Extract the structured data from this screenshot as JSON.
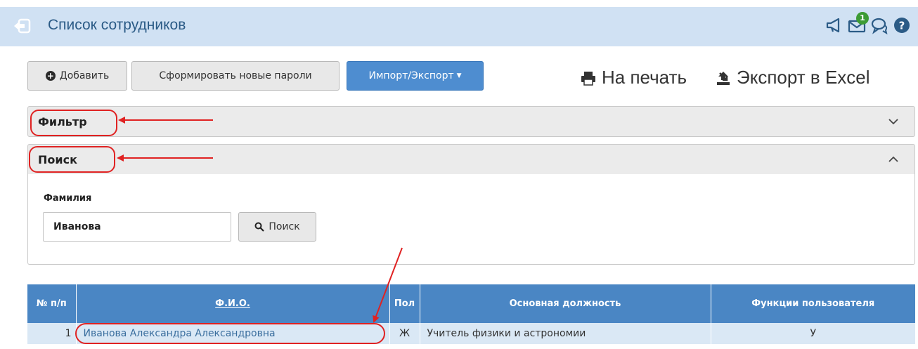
{
  "header": {
    "title": "Список сотрудников",
    "icons": [
      "back-icon",
      "megaphone-icon",
      "mail-icon",
      "chat-icon",
      "help-icon"
    ],
    "mail_badge": "1"
  },
  "toolbar": {
    "add_label": "Добавить",
    "passwords_label": "Сформировать новые пароли",
    "import_export_label": "Импорт/Экспорт",
    "print_label": "На печать",
    "excel_label": "Экспорт в Excel"
  },
  "filter_panel": {
    "title": "Фильтр",
    "state": "collapsed"
  },
  "search_panel": {
    "title": "Поиск",
    "state": "expanded",
    "surname_label": "Фамилия",
    "surname_value": "Иванова",
    "search_button": "Поиск"
  },
  "table": {
    "headers": {
      "num": "№ п/п",
      "fio": "Ф.И.О.",
      "sex": "Пол",
      "position": "Основная должность",
      "functions": "Функции пользователя"
    },
    "rows": [
      {
        "num": "1",
        "fio": "Иванова Александра Александровна",
        "sex": "Ж",
        "position": "Учитель физики и астрономии",
        "functions": "У"
      }
    ]
  },
  "colors": {
    "header_bg": "#d0e1f3",
    "title_color": "#2b5b86",
    "primary_button": "#4e8dd0",
    "table_header": "#4a86c4",
    "table_row": "#dae8f5",
    "annotation_red": "#e02222",
    "badge_green": "#3c9b35"
  }
}
